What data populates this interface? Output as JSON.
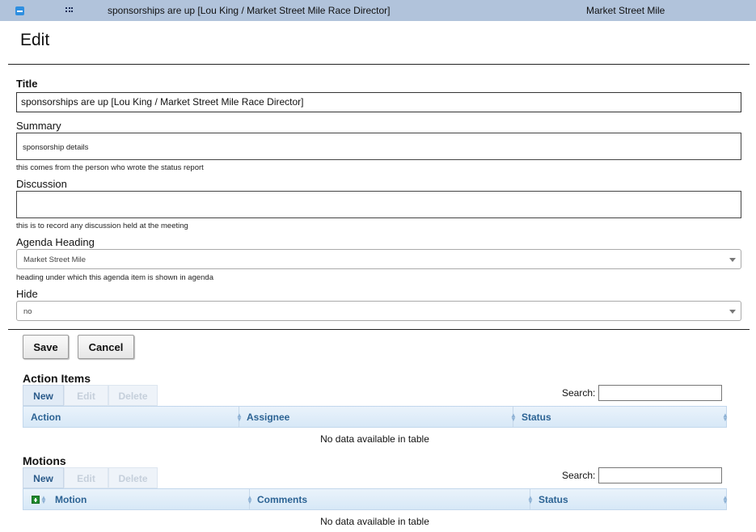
{
  "top_row": {
    "title": "sponsorships are up [Lou King / Market Street Mile Race Director]",
    "heading": "Market Street Mile"
  },
  "page": {
    "title": "Edit"
  },
  "form": {
    "title_label": "Title",
    "title_value": "sponsorships are up [Lou King / Market Street Mile Race Director]",
    "summary_label": "Summary",
    "summary_value": "sponsorship details",
    "summary_hint": "this comes from the person who wrote the status report",
    "discussion_label": "Discussion",
    "discussion_value": "",
    "discussion_hint": "this is to record any discussion held at the meeting",
    "agenda_heading_label": "Agenda Heading",
    "agenda_heading_value": "Market Street Mile",
    "agenda_heading_hint": "heading under which this agenda item is shown in agenda",
    "hide_label": "Hide",
    "hide_value": "no"
  },
  "buttons": {
    "save": "Save",
    "cancel": "Cancel"
  },
  "action_items": {
    "title": "Action Items",
    "toolbar": {
      "new": "New",
      "edit": "Edit",
      "delete": "Delete"
    },
    "search_label": "Search:",
    "columns": [
      "Action",
      "Assignee",
      "Status"
    ],
    "empty": "No data available in table"
  },
  "motions": {
    "title": "Motions",
    "toolbar": {
      "new": "New",
      "edit": "Edit",
      "delete": "Delete"
    },
    "search_label": "Search:",
    "columns": [
      "Motion",
      "Comments",
      "Status"
    ],
    "empty": "No data available in table"
  },
  "colors": {
    "top_bar": "#b1c3db",
    "table_header_text": "#2c6394",
    "expand_icon": "#1f8a2c"
  }
}
